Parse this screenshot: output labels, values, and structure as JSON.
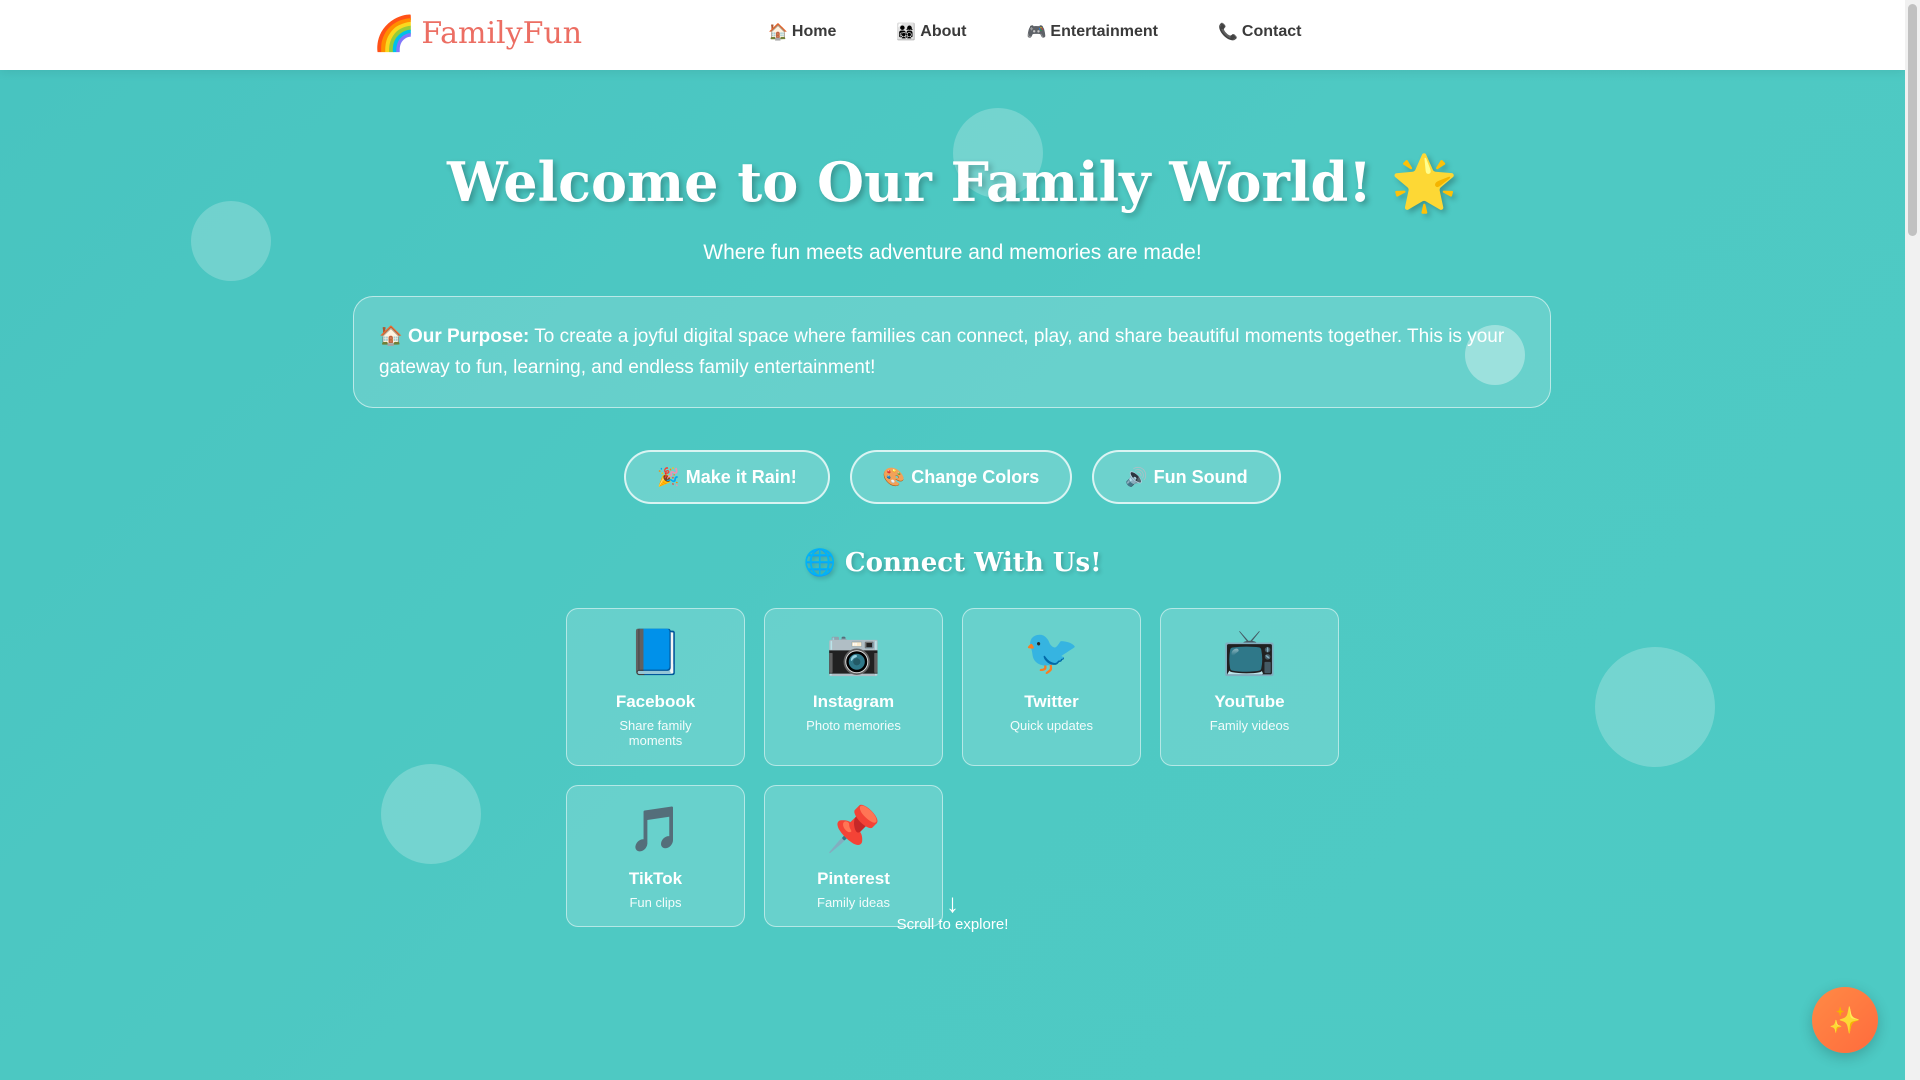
{
  "nav": {
    "logo_icon": "🌈",
    "logo_text": "FamilyFun",
    "links": [
      {
        "icon": "🏠",
        "label": "Home"
      },
      {
        "icon": "👨‍👩‍👧‍👦",
        "label": "About"
      },
      {
        "icon": "🎮",
        "label": "Entertainment"
      },
      {
        "icon": "📞",
        "label": "Contact"
      }
    ]
  },
  "hero": {
    "title": "Welcome to Our Family World! 🌟",
    "subtitle": "Where fun meets adventure and memories are made!",
    "purpose_icon": "🏠",
    "purpose_label": "Our Purpose:",
    "purpose_text": "To create a joyful digital space where families can connect, play, and share beautiful moments together. This is your gateway to fun, learning, and endless family entertainment!"
  },
  "actions": [
    {
      "icon": "🎉",
      "label": "Make it Rain!"
    },
    {
      "icon": "🎨",
      "label": "Change Colors"
    },
    {
      "icon": "🔊",
      "label": "Fun Sound"
    }
  ],
  "connect": {
    "title": "🌐 Connect With Us!",
    "cards": [
      {
        "icon": "📘",
        "name": "Facebook",
        "desc": "Share family moments"
      },
      {
        "icon": "📷",
        "name": "Instagram",
        "desc": "Photo memories"
      },
      {
        "icon": "🐦",
        "name": "Twitter",
        "desc": "Quick updates"
      },
      {
        "icon": "📺",
        "name": "YouTube",
        "desc": "Family videos"
      },
      {
        "icon": "🎵",
        "name": "TikTok",
        "desc": "Fun clips"
      },
      {
        "icon": "📌",
        "name": "Pinterest",
        "desc": "Family ideas"
      }
    ]
  },
  "scroll_hint": {
    "arrow": "↓",
    "text": "Scroll to explore!"
  },
  "fab": {
    "icon": "✨"
  },
  "colors": {
    "logo": "#ec6e63",
    "background": "#4ec9c3",
    "fab": "#ff7a42"
  }
}
